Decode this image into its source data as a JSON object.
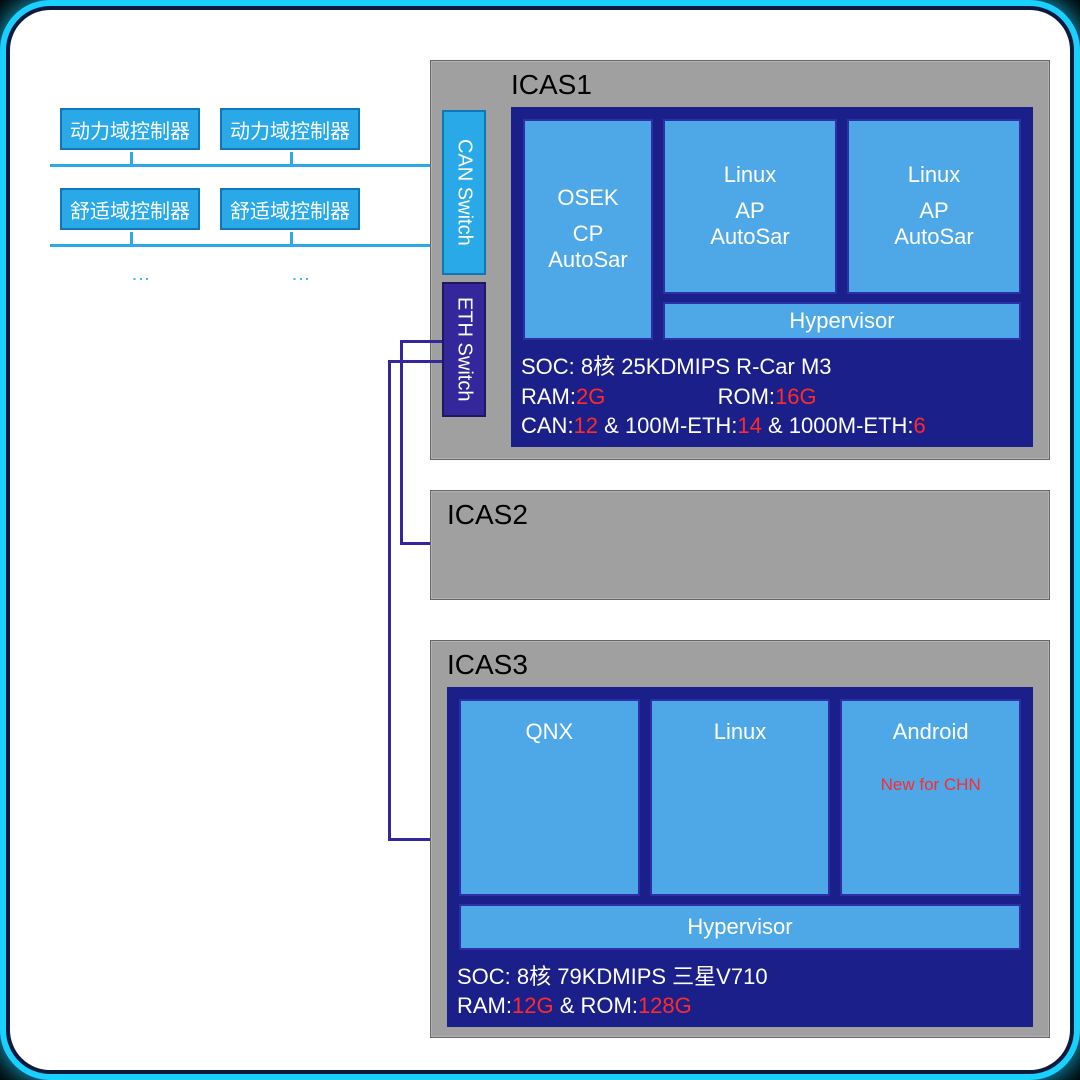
{
  "controllers": {
    "power_a": "动力域控制器",
    "power_b": "动力域控制器",
    "comfort_a": "舒适域控制器",
    "comfort_b": "舒适域控制器"
  },
  "switches": {
    "can": "CAN Switch",
    "eth": "ETH Switch"
  },
  "icas1": {
    "title": "ICAS1",
    "box1_l1": "OSEK",
    "box1_l2": "CP",
    "box1_l3": "AutoSar",
    "box2_l1": "Linux",
    "box2_l2": "AP",
    "box2_l3": "AutoSar",
    "box3_l1": "Linux",
    "box3_l2": "AP",
    "box3_l3": "AutoSar",
    "hypervisor": "Hypervisor",
    "spec_soc": "SOC: 8核 25KDMIPS R-Car M3",
    "spec_ram_k": "RAM:",
    "spec_ram_v": "2G",
    "spec_rom_k": "ROM:",
    "spec_rom_v": "16G",
    "spec_can_k": "CAN:",
    "spec_can_v": "12",
    "spec_amp1": " & 100M-ETH:",
    "spec_100m_v": "14",
    "spec_amp2": " & 1000M-ETH:",
    "spec_1000m_v": "6"
  },
  "icas2": {
    "title": "ICAS2"
  },
  "icas3": {
    "title": "ICAS3",
    "box1": "QNX",
    "box2": "Linux",
    "box3": "Android",
    "box3_sub": "New for CHN",
    "hypervisor": "Hypervisor",
    "spec_soc": "SOC: 8核 79KDMIPS 三星V710",
    "spec_ram_k": "RAM:",
    "spec_ram_v": "12G",
    "spec_amp": " & ROM:",
    "spec_rom_v": "128G"
  }
}
